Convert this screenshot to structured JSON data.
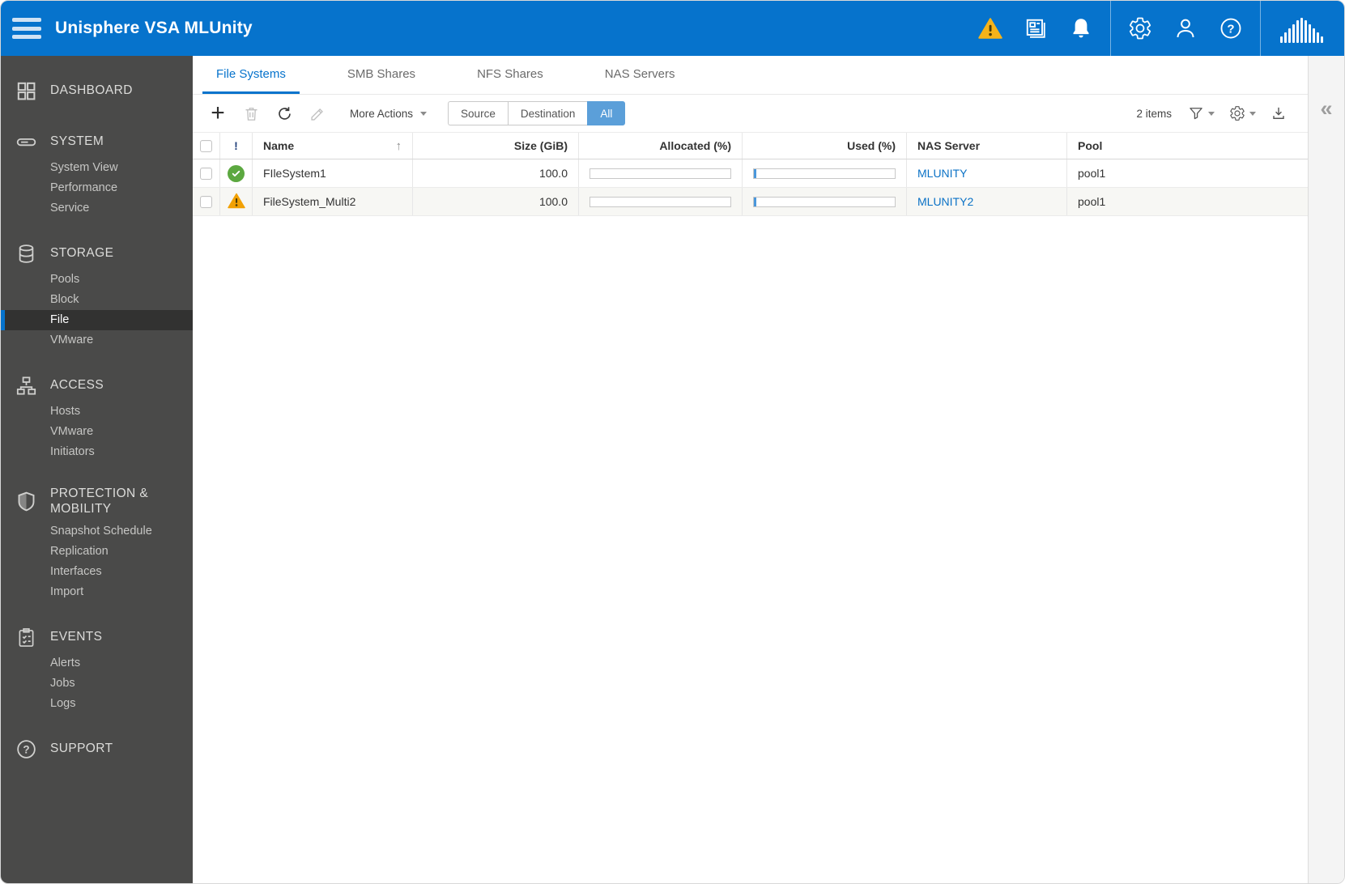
{
  "window": {
    "title": "Unisphere VSA MLUnity"
  },
  "topbar": {
    "bg_color": "#0673CC",
    "icons": [
      "warning-icon",
      "jobs-icon",
      "notifications-bell-icon",
      "settings-gear-icon",
      "user-icon",
      "help-icon",
      "brand-logo"
    ]
  },
  "sidebar": {
    "bg_color": "#4A4A49",
    "sections": [
      {
        "id": "dashboard",
        "label": "DASHBOARD",
        "icon": "dashboard-icon",
        "items": []
      },
      {
        "id": "system",
        "label": "SYSTEM",
        "icon": "system-icon",
        "items": [
          {
            "label": "System View"
          },
          {
            "label": "Performance"
          },
          {
            "label": "Service"
          }
        ]
      },
      {
        "id": "storage",
        "label": "STORAGE",
        "icon": "storage-icon",
        "items": [
          {
            "label": "Pools"
          },
          {
            "label": "Block"
          },
          {
            "label": "File",
            "active": true
          },
          {
            "label": "VMware"
          }
        ]
      },
      {
        "id": "access",
        "label": "ACCESS",
        "icon": "access-icon",
        "items": [
          {
            "label": "Hosts"
          },
          {
            "label": "VMware"
          },
          {
            "label": "Initiators"
          }
        ]
      },
      {
        "id": "protection",
        "label": "PROTECTION & MOBILITY",
        "icon": "shield-icon",
        "items": [
          {
            "label": "Snapshot Schedule"
          },
          {
            "label": "Replication"
          },
          {
            "label": "Interfaces"
          },
          {
            "label": "Import"
          }
        ]
      },
      {
        "id": "events",
        "label": "EVENTS",
        "icon": "events-icon",
        "items": [
          {
            "label": "Alerts"
          },
          {
            "label": "Jobs"
          },
          {
            "label": "Logs"
          }
        ]
      },
      {
        "id": "support",
        "label": "SUPPORT",
        "icon": "support-icon",
        "items": []
      }
    ]
  },
  "tabs": [
    {
      "label": "File Systems",
      "active": true
    },
    {
      "label": "SMB Shares",
      "active": false
    },
    {
      "label": "NFS Shares",
      "active": false
    },
    {
      "label": "NAS Servers",
      "active": false
    }
  ],
  "toolbar": {
    "more_actions_label": "More Actions",
    "segments": [
      {
        "label": "Source",
        "active": false
      },
      {
        "label": "Destination",
        "active": false
      },
      {
        "label": "All",
        "active": true
      }
    ],
    "items_count": "2 items",
    "segment_active_color": "#5B9FD9"
  },
  "collapse_glyph": "«",
  "table": {
    "columns": [
      {
        "key": "select",
        "label": ""
      },
      {
        "key": "status",
        "label": "!"
      },
      {
        "key": "name",
        "label": "Name",
        "sort": "asc",
        "sort_glyph": "↑"
      },
      {
        "key": "size",
        "label": "Size (GiB)",
        "align": "right"
      },
      {
        "key": "allocated",
        "label": "Allocated (%)",
        "align": "right"
      },
      {
        "key": "used",
        "label": "Used (%)",
        "align": "right"
      },
      {
        "key": "nas",
        "label": "NAS Server"
      },
      {
        "key": "pool",
        "label": "Pool"
      }
    ],
    "rows": [
      {
        "status": "ok",
        "name": "FIleSystem1",
        "size": "100.0",
        "allocated_pct": 0,
        "used_pct": 2,
        "nas_server": "MLUNITY",
        "pool": "pool1"
      },
      {
        "status": "warning",
        "name": "FileSystem_Multi2",
        "size": "100.0",
        "allocated_pct": 0,
        "used_pct": 2,
        "nas_server": "MLUNITY2",
        "pool": "pool1"
      }
    ]
  },
  "colors": {
    "accent": "#0673CC",
    "link": "#0B72C6",
    "status_ok": "#5CA840",
    "status_warning": "#F2A104",
    "progress_fill": "#4A97DB"
  }
}
